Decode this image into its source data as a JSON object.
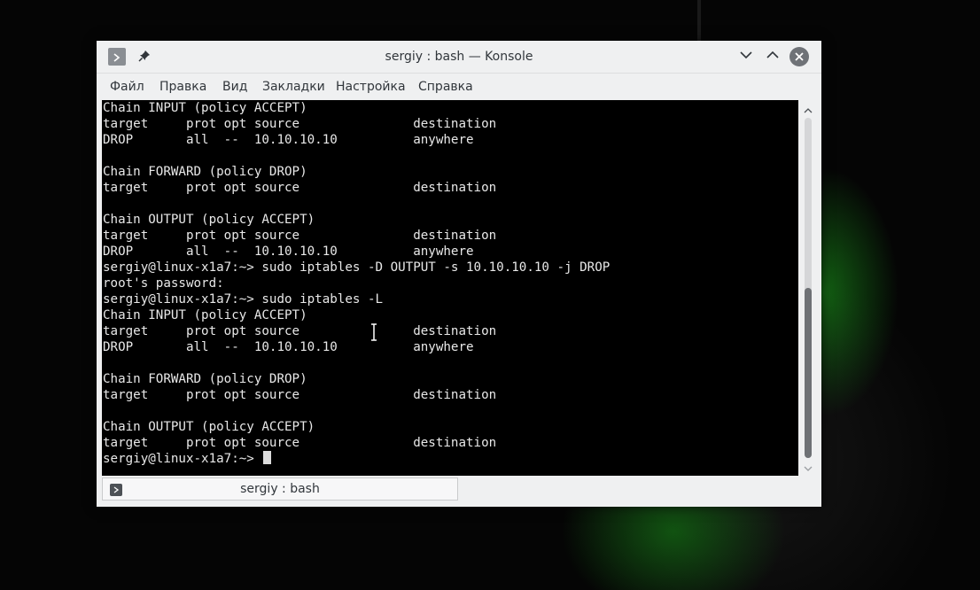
{
  "window": {
    "title": "sergiy : bash — Konsole"
  },
  "menubar": {
    "items": [
      "Файл",
      "Правка",
      "Вид",
      "Закладки",
      "Настройка",
      "Справка"
    ]
  },
  "terminal": {
    "lines": [
      "Chain INPUT (policy ACCEPT)",
      "target     prot opt source               destination",
      "DROP       all  --  10.10.10.10          anywhere",
      "",
      "Chain FORWARD (policy DROP)",
      "target     prot opt source               destination",
      "",
      "Chain OUTPUT (policy ACCEPT)",
      "target     prot opt source               destination",
      "DROP       all  --  10.10.10.10          anywhere",
      "sergiy@linux-x1a7:~> sudo iptables -D OUTPUT -s 10.10.10.10 -j DROP",
      "root's password:",
      "sergiy@linux-x1a7:~> sudo iptables -L",
      "Chain INPUT (policy ACCEPT)",
      "target     prot opt source               destination",
      "DROP       all  --  10.10.10.10          anywhere",
      "",
      "Chain FORWARD (policy DROP)",
      "target     prot opt source               destination",
      "",
      "Chain OUTPUT (policy ACCEPT)",
      "target     prot opt source               destination",
      "sergiy@linux-x1a7:~> "
    ]
  },
  "tabs": [
    {
      "label": "sergiy : bash"
    }
  ],
  "colors": {
    "terminal_bg": "#000000",
    "terminal_fg": "#e8e8e8",
    "chrome_bg": "#eff0f1",
    "close_button": "#6f7277"
  },
  "icons": {
    "window_menu": "terminal-prompt-icon",
    "pin": "pin-icon",
    "minimize": "chevron-down-icon",
    "maximize": "chevron-up-icon",
    "close": "close-icon",
    "tab": "terminal-prompt-icon",
    "mouse_cursor": "text-cursor-icon"
  }
}
